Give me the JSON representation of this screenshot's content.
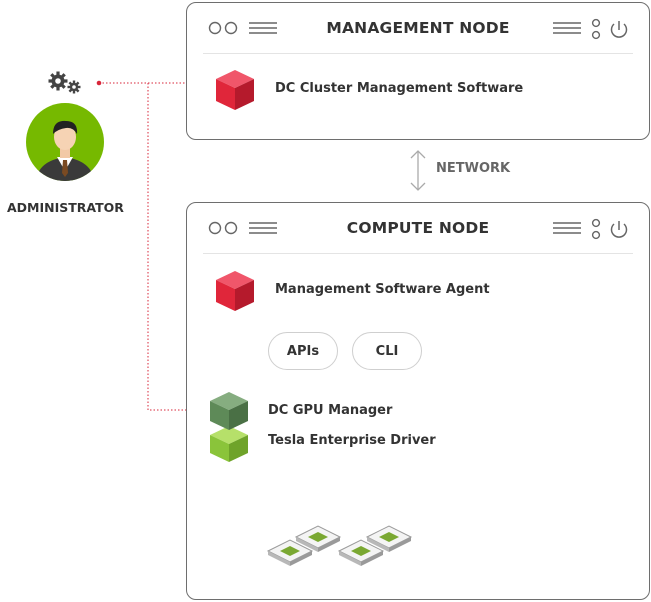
{
  "management_node": {
    "title": "MANAGEMENT NODE",
    "software_label": "DC Cluster Management Software"
  },
  "network": {
    "label": "NETWORK"
  },
  "compute_node": {
    "title": "COMPUTE NODE",
    "agent_label": "Management Software Agent",
    "apis_label": "APIs",
    "cli_label": "CLI",
    "gpu_manager_label": "DC GPU Manager",
    "driver_label": "Tesla Enterprise Driver"
  },
  "administrator": {
    "label": "ADMINISTRATOR"
  },
  "colors": {
    "red_cube": "#e0263a",
    "dark_green_cube": "#5e8a58",
    "light_green_cube": "#8ac43a",
    "connector_red": "#d8263a",
    "connector_green": "#7fb83a",
    "avatar_green": "#76b900"
  },
  "icons": [
    "window-dots-icon",
    "menu-lines-icon",
    "vertical-dots-icon",
    "power-icon",
    "gear-icon",
    "person-icon",
    "cube-icon",
    "gpu-chip-icon"
  ]
}
